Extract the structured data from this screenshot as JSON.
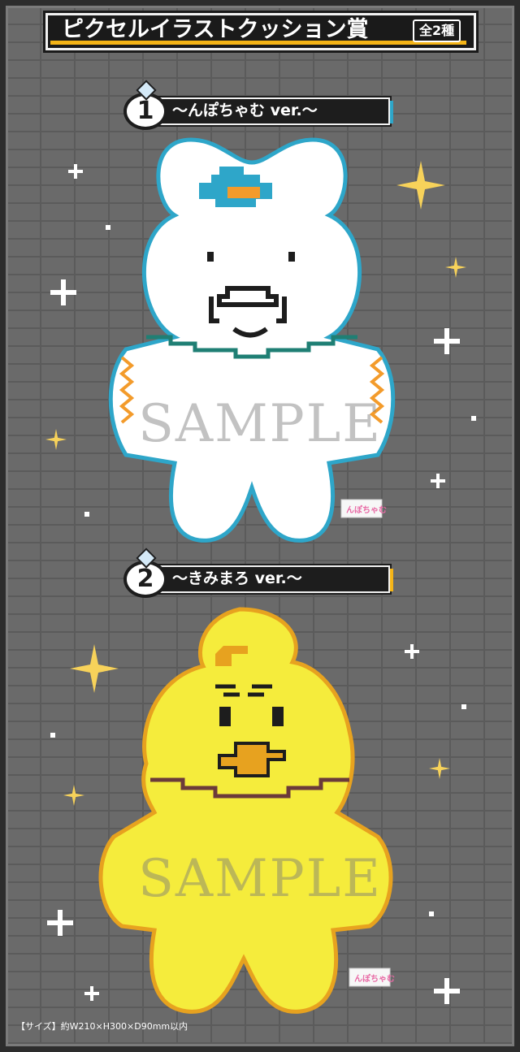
{
  "header": {
    "title": "ピクセルイラストクッション賞",
    "badge": "全2種"
  },
  "items": [
    {
      "number": "1",
      "label": "〜んぽちゃむ ver.〜",
      "tag_color": "#2ea6c9",
      "body_color": "#ffffff",
      "trim_color": "#2ea6c9"
    },
    {
      "number": "2",
      "label": "〜きみまろ ver.〜",
      "tag_color": "#f4b417",
      "body_color": "#f5ec3c",
      "trim_color": "#e7a21f"
    }
  ],
  "watermark": "SAMPLE",
  "size_note": "【サイズ】約W210×H300×D90mm以内",
  "colors": {
    "background": "#6a6a6a",
    "sparkle_gold": "#f7d25a"
  }
}
